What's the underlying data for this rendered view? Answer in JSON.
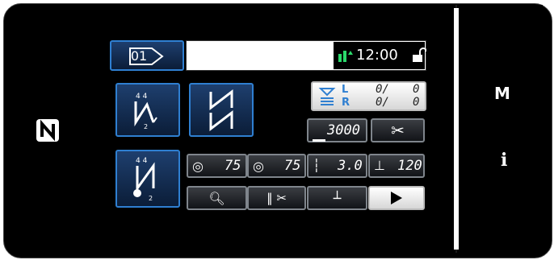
{
  "header": {
    "pattern_number": "01",
    "time": "12:00"
  },
  "counter": {
    "label_left": "L",
    "label_right": "R",
    "left_value": "0/",
    "left_total": "0",
    "right_value": "0/",
    "right_total": "0"
  },
  "speed": {
    "value": "3000"
  },
  "tension": {
    "left": "75",
    "right": "75"
  },
  "stitch_length": {
    "value": "3.0"
  },
  "presser_foot": {
    "value": "120"
  },
  "side_panel": {
    "mode_label": "M",
    "info_label": "i"
  },
  "colors": {
    "accent": "#2f7fd1",
    "button_bg": "#1e3f6e",
    "screen": "#000000"
  }
}
